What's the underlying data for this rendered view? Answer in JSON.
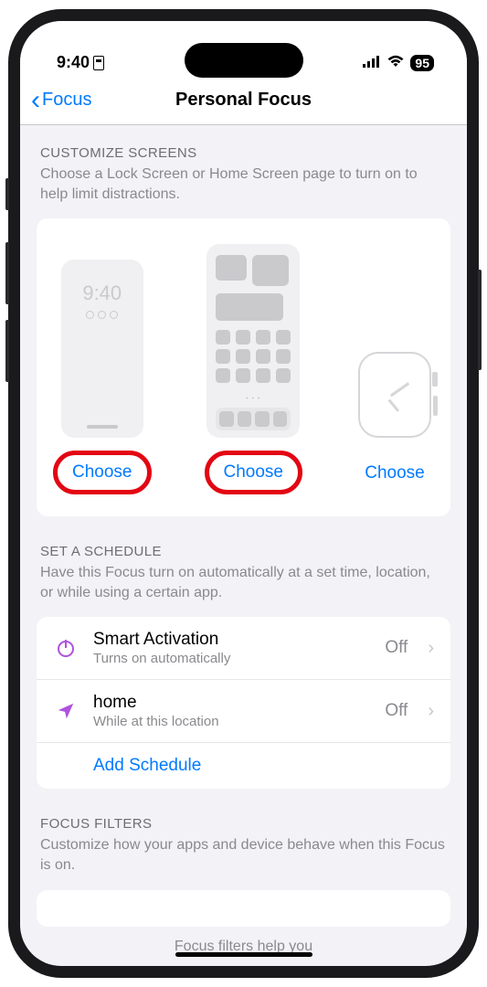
{
  "status": {
    "time": "9:40",
    "battery": "95"
  },
  "nav": {
    "back": "Focus",
    "title": "Personal Focus"
  },
  "customize": {
    "title": "CUSTOMIZE SCREENS",
    "desc": "Choose a Lock Screen or Home Screen page to turn on to help limit distractions.",
    "lock_preview_time": "9:40",
    "choose_lock": "Choose",
    "choose_home": "Choose",
    "choose_watch": "Choose"
  },
  "schedule": {
    "title": "SET A SCHEDULE",
    "desc": "Have this Focus turn on automatically at a set time, location, or while using a certain app.",
    "rows": [
      {
        "title": "Smart Activation",
        "sub": "Turns on automatically",
        "value": "Off"
      },
      {
        "title": "home",
        "sub": "While at this location",
        "value": "Off"
      }
    ],
    "add": "Add Schedule"
  },
  "filters": {
    "title": "FOCUS FILTERS",
    "desc": "Customize how your apps and device behave when this Focus is on.",
    "hint": "Focus filters help you"
  }
}
